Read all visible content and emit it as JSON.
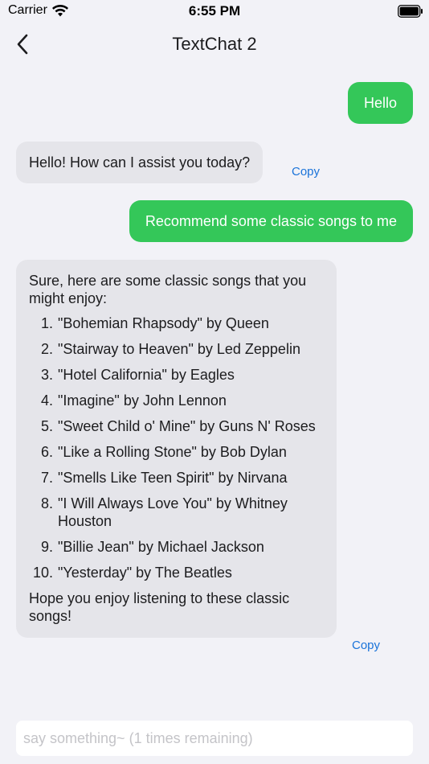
{
  "status_bar": {
    "carrier": "Carrier",
    "time": "6:55 PM"
  },
  "nav": {
    "title": "TextChat 2",
    "back_icon": "chevron-left-icon"
  },
  "messages": [
    {
      "role": "user",
      "text": "Hello"
    },
    {
      "role": "assistant",
      "text": "Hello! How can I assist you today?",
      "action": "Copy"
    },
    {
      "role": "user",
      "text": "Recommend some classic songs to me"
    },
    {
      "role": "assistant",
      "intro": "Sure, here are some classic songs that you might enjoy:",
      "songs": [
        {
          "num": "1.",
          "text": "\"Bohemian Rhapsody\" by Queen"
        },
        {
          "num": "2.",
          "text": "\"Stairway to Heaven\" by Led Zeppelin"
        },
        {
          "num": "3.",
          "text": "\"Hotel California\" by Eagles"
        },
        {
          "num": "4.",
          "text": "\"Imagine\" by John Lennon"
        },
        {
          "num": "5.",
          "text": "\"Sweet Child o' Mine\" by Guns N' Roses"
        },
        {
          "num": "6.",
          "text": "\"Like a Rolling Stone\" by Bob Dylan"
        },
        {
          "num": "7.",
          "text": "\"Smells Like Teen Spirit\" by Nirvana"
        },
        {
          "num": "8.",
          "text": "\"I Will Always Love You\" by Whitney Houston"
        },
        {
          "num": "9.",
          "text": "\"Billie Jean\" by Michael Jackson"
        },
        {
          "num": "10.",
          "text": "\"Yesterday\" by The Beatles"
        }
      ],
      "outro": "Hope you enjoy listening to these classic songs!",
      "action": "Copy"
    }
  ],
  "input": {
    "placeholder": "say something~ (1 times remaining)",
    "value": ""
  },
  "colors": {
    "user_bubble": "#34c759",
    "assistant_bubble": "#e5e5ea",
    "link": "#1a73d9",
    "background": "#f2f2f7"
  }
}
